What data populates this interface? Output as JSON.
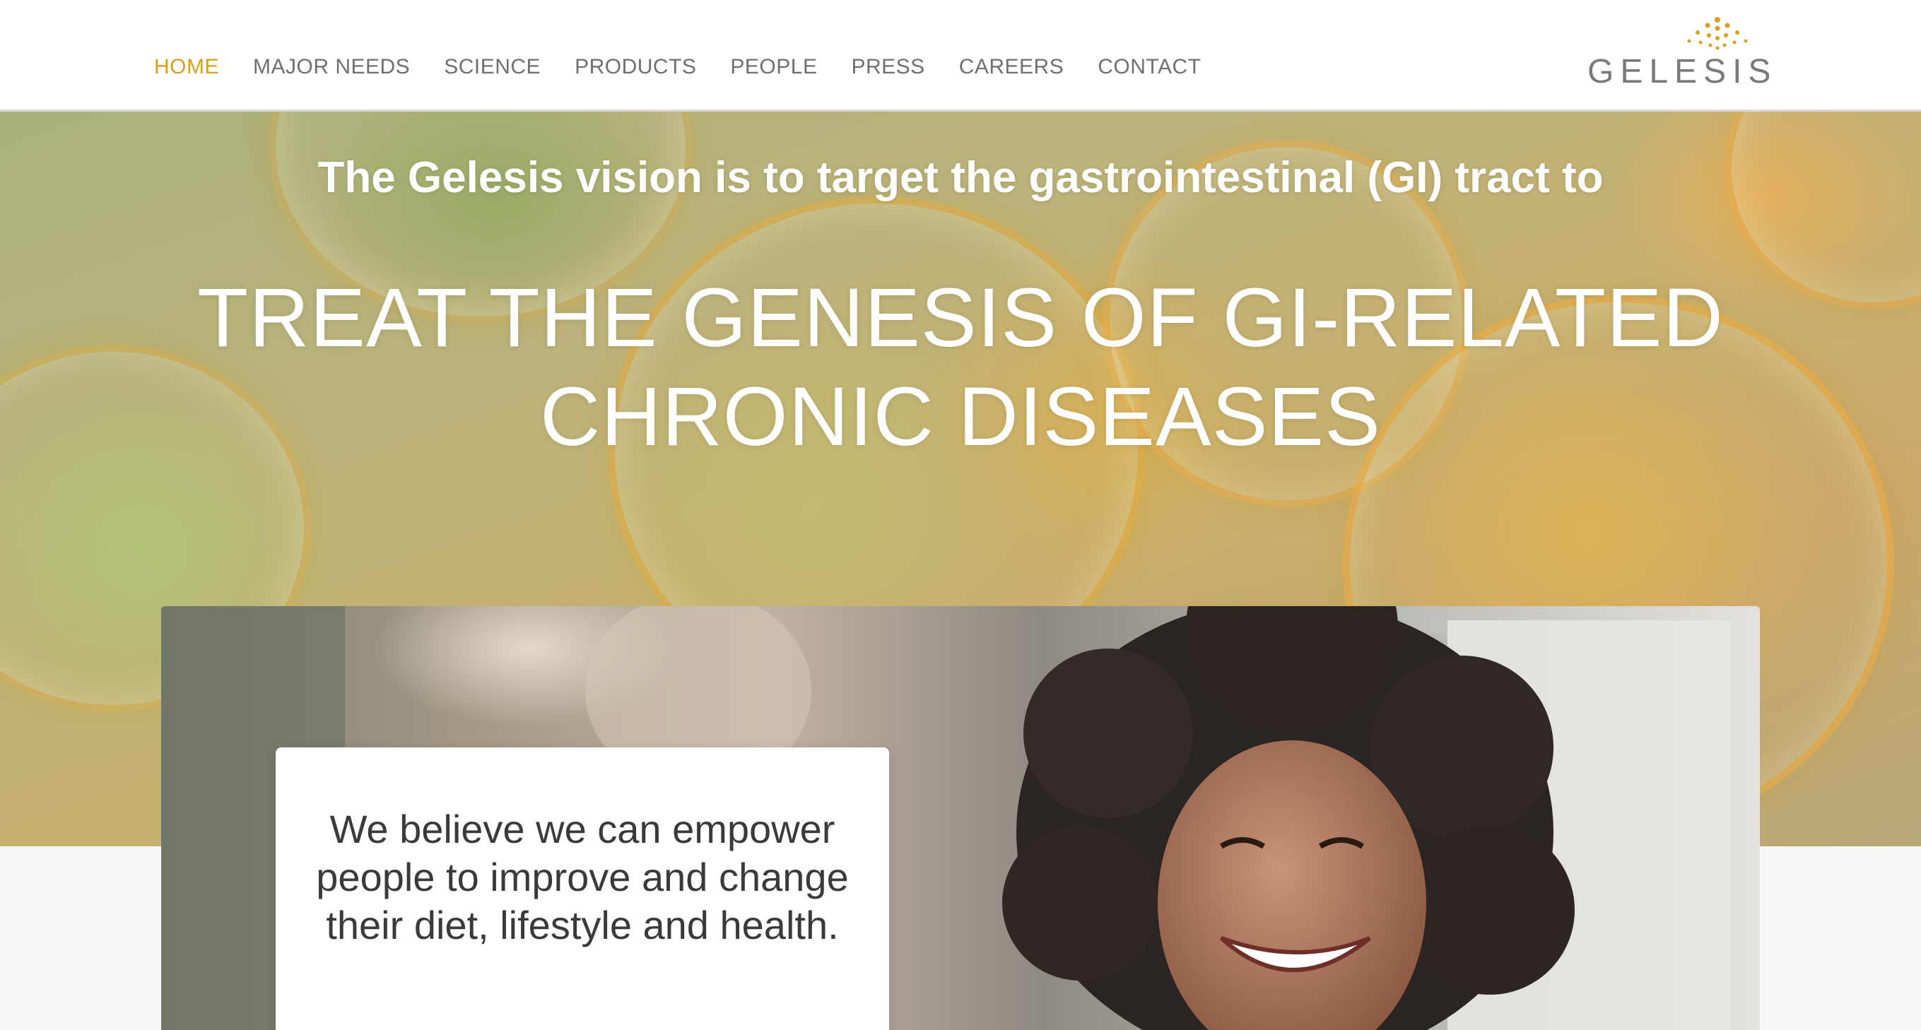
{
  "nav": {
    "items": [
      {
        "label": "HOME",
        "active": true
      },
      {
        "label": "MAJOR NEEDS",
        "active": false
      },
      {
        "label": "SCIENCE",
        "active": false
      },
      {
        "label": "PRODUCTS",
        "active": false
      },
      {
        "label": "PEOPLE",
        "active": false
      },
      {
        "label": "PRESS",
        "active": false
      },
      {
        "label": "CAREERS",
        "active": false
      },
      {
        "label": "CONTACT",
        "active": false
      }
    ]
  },
  "logo": {
    "text": "GELESIS",
    "icon": "dot-burst-icon"
  },
  "hero": {
    "subtitle": "The Gelesis vision is to target the gastrointestinal (GI) tract to",
    "title_line1": "TREAT THE GENESIS OF GI-RELATED",
    "title_line2": "CHRONIC DISEASES"
  },
  "feature": {
    "quote": "We believe we can empower people to improve and change their diet, lifestyle and health."
  },
  "colors": {
    "accent": "#d8a022",
    "nav_text": "#6f6f6f",
    "logo_text": "#7a7a7a",
    "hero_text": "#ffffff",
    "quote_text": "#3a3a3a"
  }
}
